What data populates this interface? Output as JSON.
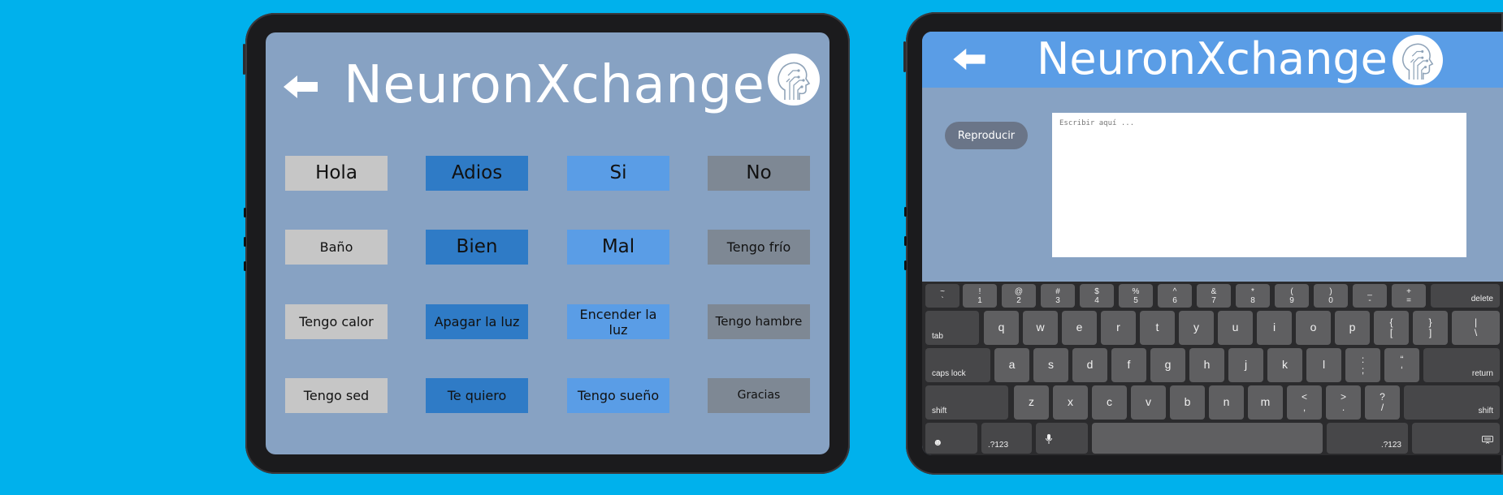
{
  "left_app": {
    "title": "NeuronXchange",
    "phrases": [
      [
        "Hola",
        "Adios",
        "Si",
        "No"
      ],
      [
        "Baño",
        "Bien",
        "Mal",
        "Tengo frío"
      ],
      [
        "Tengo calor",
        "Apagar la luz",
        "Encender la luz",
        "Tengo hambre"
      ],
      [
        "Tengo sed",
        "Te quiero",
        "Tengo sueño",
        "Gracias"
      ]
    ]
  },
  "right_app": {
    "title": "NeuronXchange",
    "play_label": "Reproducir",
    "text_placeholder": "Escribir aquí ...",
    "keyboard": {
      "row1": [
        [
          "~",
          "`"
        ],
        [
          "!",
          "1"
        ],
        [
          "@",
          "2"
        ],
        [
          "#",
          "3"
        ],
        [
          "$",
          "4"
        ],
        [
          "%",
          "5"
        ],
        [
          "^",
          "6"
        ],
        [
          "&",
          "7"
        ],
        [
          "*",
          "8"
        ],
        [
          "(",
          "9"
        ],
        [
          ")",
          "0"
        ],
        [
          "_",
          "-"
        ],
        [
          "+",
          "="
        ]
      ],
      "delete": "delete",
      "tab": "tab",
      "row2": [
        "q",
        "w",
        "e",
        "r",
        "t",
        "y",
        "u",
        "i",
        "o",
        "p"
      ],
      "row2_sym": [
        [
          "{",
          "["
        ],
        [
          "}",
          "]"
        ],
        [
          "|",
          "\\"
        ]
      ],
      "caps": "caps lock",
      "row3": [
        "a",
        "s",
        "d",
        "f",
        "g",
        "h",
        "j",
        "k",
        "l"
      ],
      "row3_sym": [
        [
          ":",
          ";"
        ],
        [
          "“",
          "‘"
        ]
      ],
      "return": "return",
      "shift": "shift",
      "row4": [
        "z",
        "x",
        "c",
        "v",
        "b",
        "n",
        "m"
      ],
      "row4_sym": [
        [
          "<",
          ","
        ],
        [
          ">",
          "."
        ],
        [
          "?",
          "/"
        ]
      ],
      "numbers": ".?123"
    }
  },
  "colors": {
    "background": "#00b1ec",
    "screen": "#87a2c3",
    "header": "#5a9de6",
    "phrase_gray": "#c6c6c6",
    "phrase_dark_blue": "#2f7bc6",
    "phrase_light_blue": "#5a9de6",
    "phrase_slate": "#7e8894"
  },
  "icons": [
    "back-arrow-icon",
    "head-circuit-logo-icon",
    "emoji-icon",
    "microphone-icon",
    "keyboard-hide-icon"
  ]
}
